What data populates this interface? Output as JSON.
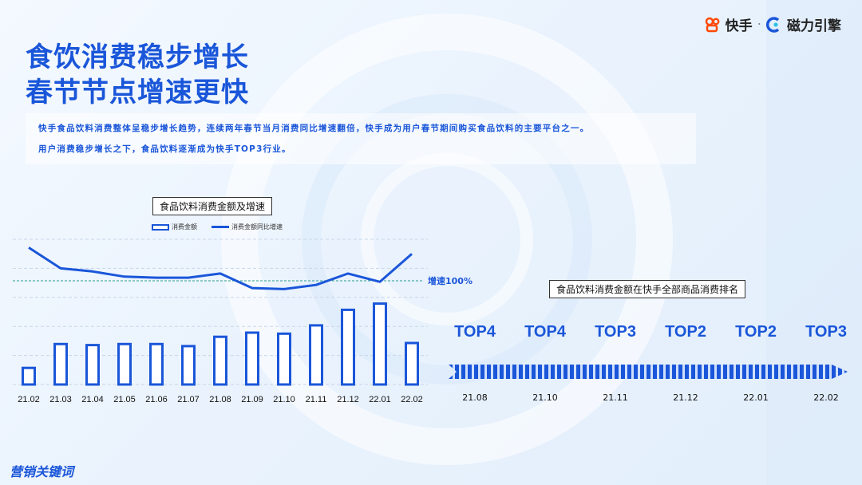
{
  "brand": {
    "kuaishou": "快手",
    "separator": "·",
    "cili": "磁力引擎"
  },
  "title_line1": "食饮消费稳步增长",
  "title_line2": "春节节点增速更快",
  "description_line1": "快手食品饮料消费整体呈稳步增长趋势，连续两年春节当月消费同比增速翻倍，快手成为用户春节期间购买食品饮料的主要平台之一。",
  "description_line2": "用户消费稳步增长之下，食品饮料逐渐成为快手TOP3行业。",
  "chart_data": [
    {
      "type": "bar",
      "title": "食品饮料消费金额及增速",
      "categories": [
        "21.02",
        "21.03",
        "21.04",
        "21.05",
        "21.06",
        "21.07",
        "21.08",
        "21.09",
        "21.10",
        "21.11",
        "21.12",
        "22.01",
        "22.02"
      ],
      "series": [
        {
          "name": "消费金额",
          "type": "bar",
          "values": [
            16,
            39,
            38,
            39,
            39,
            37,
            46,
            50,
            49,
            57,
            72,
            78,
            40
          ]
        },
        {
          "name": "消费金额同比增速",
          "type": "line",
          "values": [
            132,
            112,
            109,
            104,
            103,
            103,
            107,
            93,
            92,
            96,
            107,
            99,
            126
          ]
        }
      ],
      "reference_line": {
        "label": "增速100%",
        "value": 100
      },
      "ylim": [
        0,
        140
      ],
      "grid": true,
      "legend": "top-left",
      "colors": {
        "bar_stroke": "#1a56d9",
        "bar_fill": "#ffffff",
        "line": "#1a56d9",
        "reference": "#2a9d8f"
      }
    },
    {
      "type": "table",
      "title": "食品饮料消费金额在快手全部商品消费排名",
      "columns": [
        "21.08",
        "21.10",
        "21.11",
        "21.12",
        "22.01",
        "22.02"
      ],
      "ranks": [
        "TOP4",
        "TOP4",
        "TOP3",
        "TOP2",
        "TOP2",
        "TOP3"
      ]
    }
  ],
  "footer_logo": "营销关键词"
}
